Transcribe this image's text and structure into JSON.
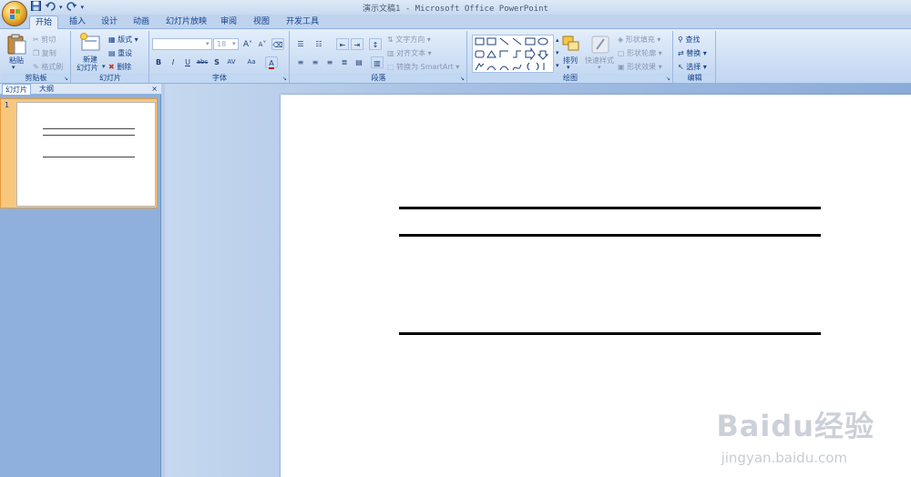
{
  "window": {
    "title": "演示文稿1 - Microsoft Office PowerPoint"
  },
  "tabs": [
    "开始",
    "插入",
    "设计",
    "动画",
    "幻灯片放映",
    "审阅",
    "视图",
    "开发工具"
  ],
  "clipboard": {
    "paste": "粘贴",
    "cut": "剪切",
    "copy": "复制",
    "format_painter": "格式刷",
    "group": "剪贴板"
  },
  "slides_group": {
    "new_line1": "新建",
    "new_line2": "幻灯片",
    "layout": "版式",
    "reset": "重设",
    "delete": "删除",
    "group": "幻灯片"
  },
  "font": {
    "size": "18",
    "group": "字体",
    "bold": "B",
    "italic": "I",
    "underline": "U",
    "strike": "abc",
    "shadow": "S",
    "spacing": "AV",
    "case": "Aa",
    "grow": "A",
    "shrink": "A"
  },
  "paragraph": {
    "text_direction": "文字方向",
    "align_text": "对齐文本",
    "smartart": "转换为 SmartArt",
    "group": "段落"
  },
  "drawing": {
    "arrange": "排列",
    "quick_styles": "快速样式",
    "shape_fill": "形状填充",
    "shape_outline": "形状轮廓",
    "shape_effects": "形状效果",
    "group": "绘图"
  },
  "editing": {
    "find": "查找",
    "replace": "替换",
    "select": "选择",
    "group": "编辑"
  },
  "panel": {
    "tab_slides": "幻灯片",
    "tab_outline": "大纲",
    "close": "×",
    "slide_number": "1"
  },
  "watermark": {
    "main": "Baidu经验",
    "url": "jingyan.baidu.com"
  },
  "colors": {
    "accent_tab": "#e4edf9",
    "selected_thumb": "#f8c77e",
    "workspace": "#8aabd8"
  }
}
